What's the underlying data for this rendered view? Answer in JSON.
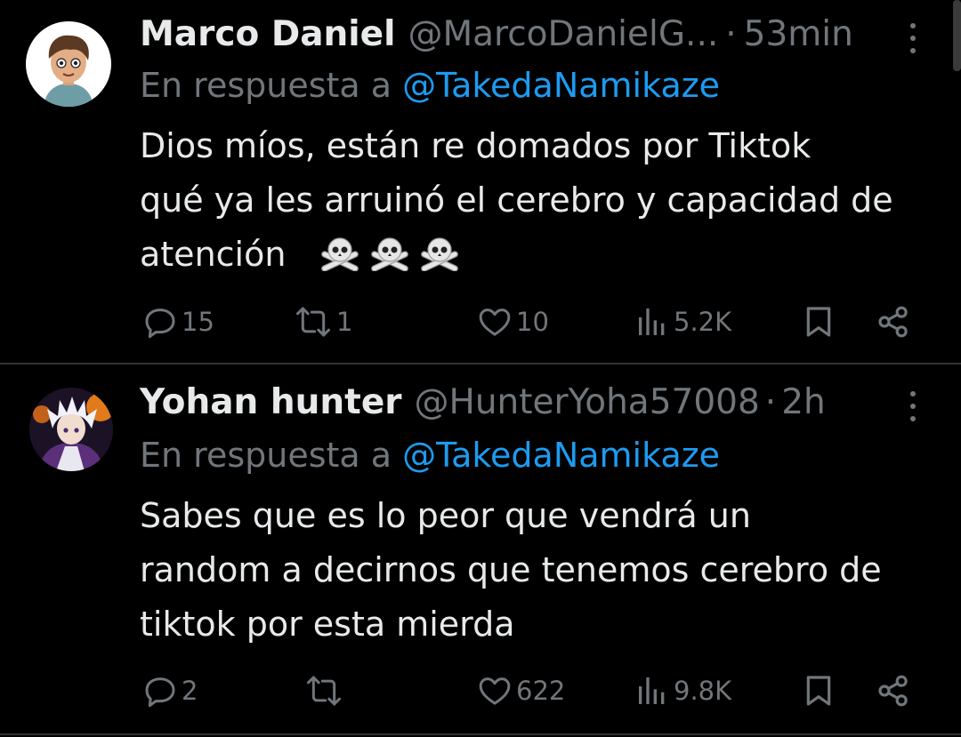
{
  "tweets": [
    {
      "name": "Marco Daniel",
      "handle": "@MarcoDanielG...",
      "dot": "·",
      "time": "53min",
      "reply_prefix": "En respuesta a",
      "reply_to": "@TakedaNamikaze",
      "text_lines": [
        "Dios míos, están re domados por Tiktok",
        "qué ya les arruinó el cerebro y capacidad de",
        "atención"
      ],
      "emoji": "skull-and-crossbones x3",
      "replies": "15",
      "reposts": "1",
      "likes": "10",
      "views": "5.2K"
    },
    {
      "name": "Yohan hunter",
      "handle": "@HunterYoha57008",
      "dot": "·",
      "time": "2h",
      "reply_prefix": "En respuesta a",
      "reply_to": "@TakedaNamikaze",
      "text_lines": [
        "Sabes que es lo peor que vendrá un",
        "random a decirnos que tenemos cerebro de",
        "tiktok por esta mierda"
      ],
      "replies": "2",
      "reposts": "",
      "likes": "622",
      "views": "9.8K"
    }
  ],
  "icons": {
    "reply": "speech-bubble-icon",
    "repost": "repost-arrows-icon",
    "like": "heart-icon",
    "views": "bar-chart-icon",
    "bookmark": "bookmark-icon",
    "share": "share-icon",
    "more": "more-vertical-icon"
  },
  "colors": {
    "background": "#000000",
    "text": "#e7e9ea",
    "muted": "#71767b",
    "link": "#1d9bf0",
    "divider": "#2f3336"
  }
}
